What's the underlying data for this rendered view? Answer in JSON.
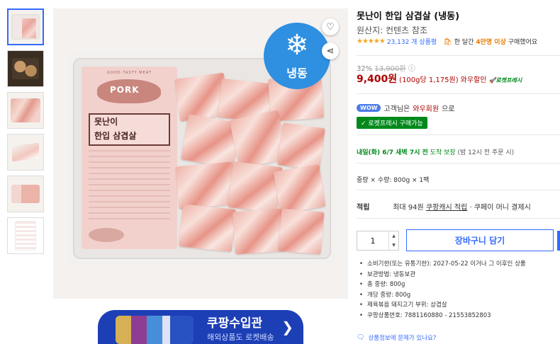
{
  "product": {
    "title": "못난이 한입 삼겹살 (냉동)",
    "origin": "원산지: 컨텐츠 참조",
    "rating_stars": "★★★★★",
    "review_count": "23,132 개 상품평",
    "bought_prefix": "한 달간",
    "bought_count": "4만명 이상",
    "bought_suffix": "구매했어요"
  },
  "image": {
    "frozen_badge": "냉동",
    "label_brand": "GOOD TASTY MEAT",
    "label_pork": "PORK",
    "label_name_1": "못난이",
    "label_name_2": "한입 삼겹살",
    "thumbnail_count": 6
  },
  "price": {
    "discount_pct": "32%",
    "original": "13,900원",
    "sale": "9,400원",
    "unit_price": "(100g당 1,175원)",
    "wow_sale": "와우할인",
    "rocket": "로켓프레시"
  },
  "wow": {
    "badge": "WOW",
    "text_prefix": "고객님은",
    "link": "와우회원",
    "text_suffix": "으로",
    "fresh_badge": "✓ 로켓프레시 구매가능"
  },
  "delivery": {
    "date": "내일(화) 6/7 새벽 7시 전",
    "guarantee": "도착 보장",
    "note": "(밤 12시 전 주문 시)"
  },
  "options": {
    "qty_info": "중량 × 수량: 800g × 1팩"
  },
  "points": {
    "label": "적립",
    "max": "최대 94원",
    "link": "쿠팡캐시 적립",
    "tail": "· 쿠페이 머니 결제시"
  },
  "purchase": {
    "quantity": "1",
    "cart_label": "장바구니 담기"
  },
  "details": [
    "소비기한(또는 유통기한): 2027-05-22 이거나 그 이후인 상품",
    "보관방법: 냉동보관",
    "총 중량: 800g",
    "개당 중량: 800g",
    "제육볶음 돼지고기 부위: 삼겹살",
    "쿠팡상품번호: 7881160880 - 21553852803"
  ],
  "report_link": "상품정보에 문제가 있나요?",
  "banner": {
    "title": "쿠팡수입관",
    "subtitle": "해외상품도 로켓배송"
  },
  "colors": {
    "price_red": "#ae0000",
    "accent_blue": "#346aff",
    "fresh_green": "#00891a",
    "bought_orange": "#e57b00",
    "frozen_blue": "#2f8fe0"
  }
}
